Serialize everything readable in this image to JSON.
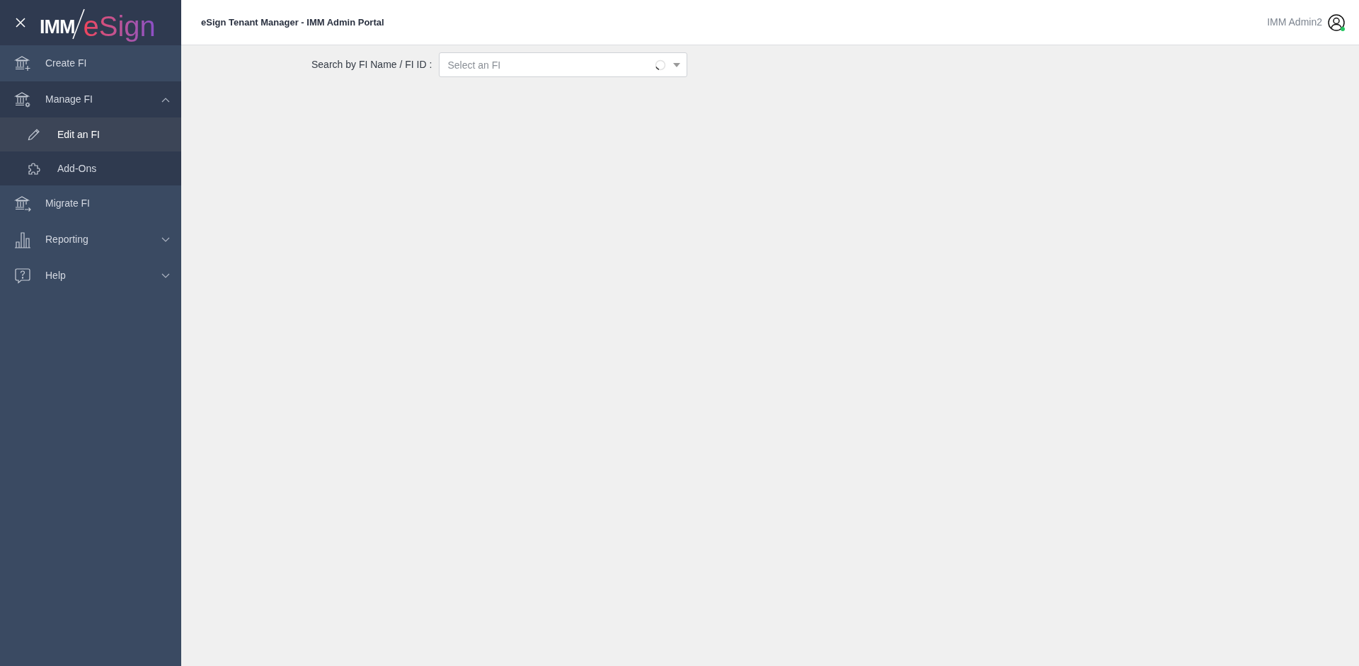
{
  "logo": {
    "left": "IMM",
    "right": "eSign"
  },
  "sidebar": {
    "items": [
      {
        "label": "Create FI",
        "expandable": false,
        "expanded": false,
        "selected": false
      },
      {
        "label": "Manage FI",
        "expandable": true,
        "expanded": true,
        "selected": false,
        "children": [
          {
            "label": "Edit an FI",
            "selected": true
          },
          {
            "label": "Add-Ons",
            "selected": false
          }
        ]
      },
      {
        "label": "Migrate FI",
        "expandable": false,
        "expanded": false,
        "selected": false
      },
      {
        "label": "Reporting",
        "expandable": true,
        "expanded": false,
        "selected": false
      },
      {
        "label": "Help",
        "expandable": true,
        "expanded": false,
        "selected": false
      }
    ]
  },
  "header": {
    "title": "eSign Tenant Manager - IMM Admin Portal",
    "user": "IMM Admin2",
    "online": true
  },
  "search": {
    "label": "Search by FI Name / FI ID :",
    "placeholder": "Select an FI",
    "loading": true
  }
}
